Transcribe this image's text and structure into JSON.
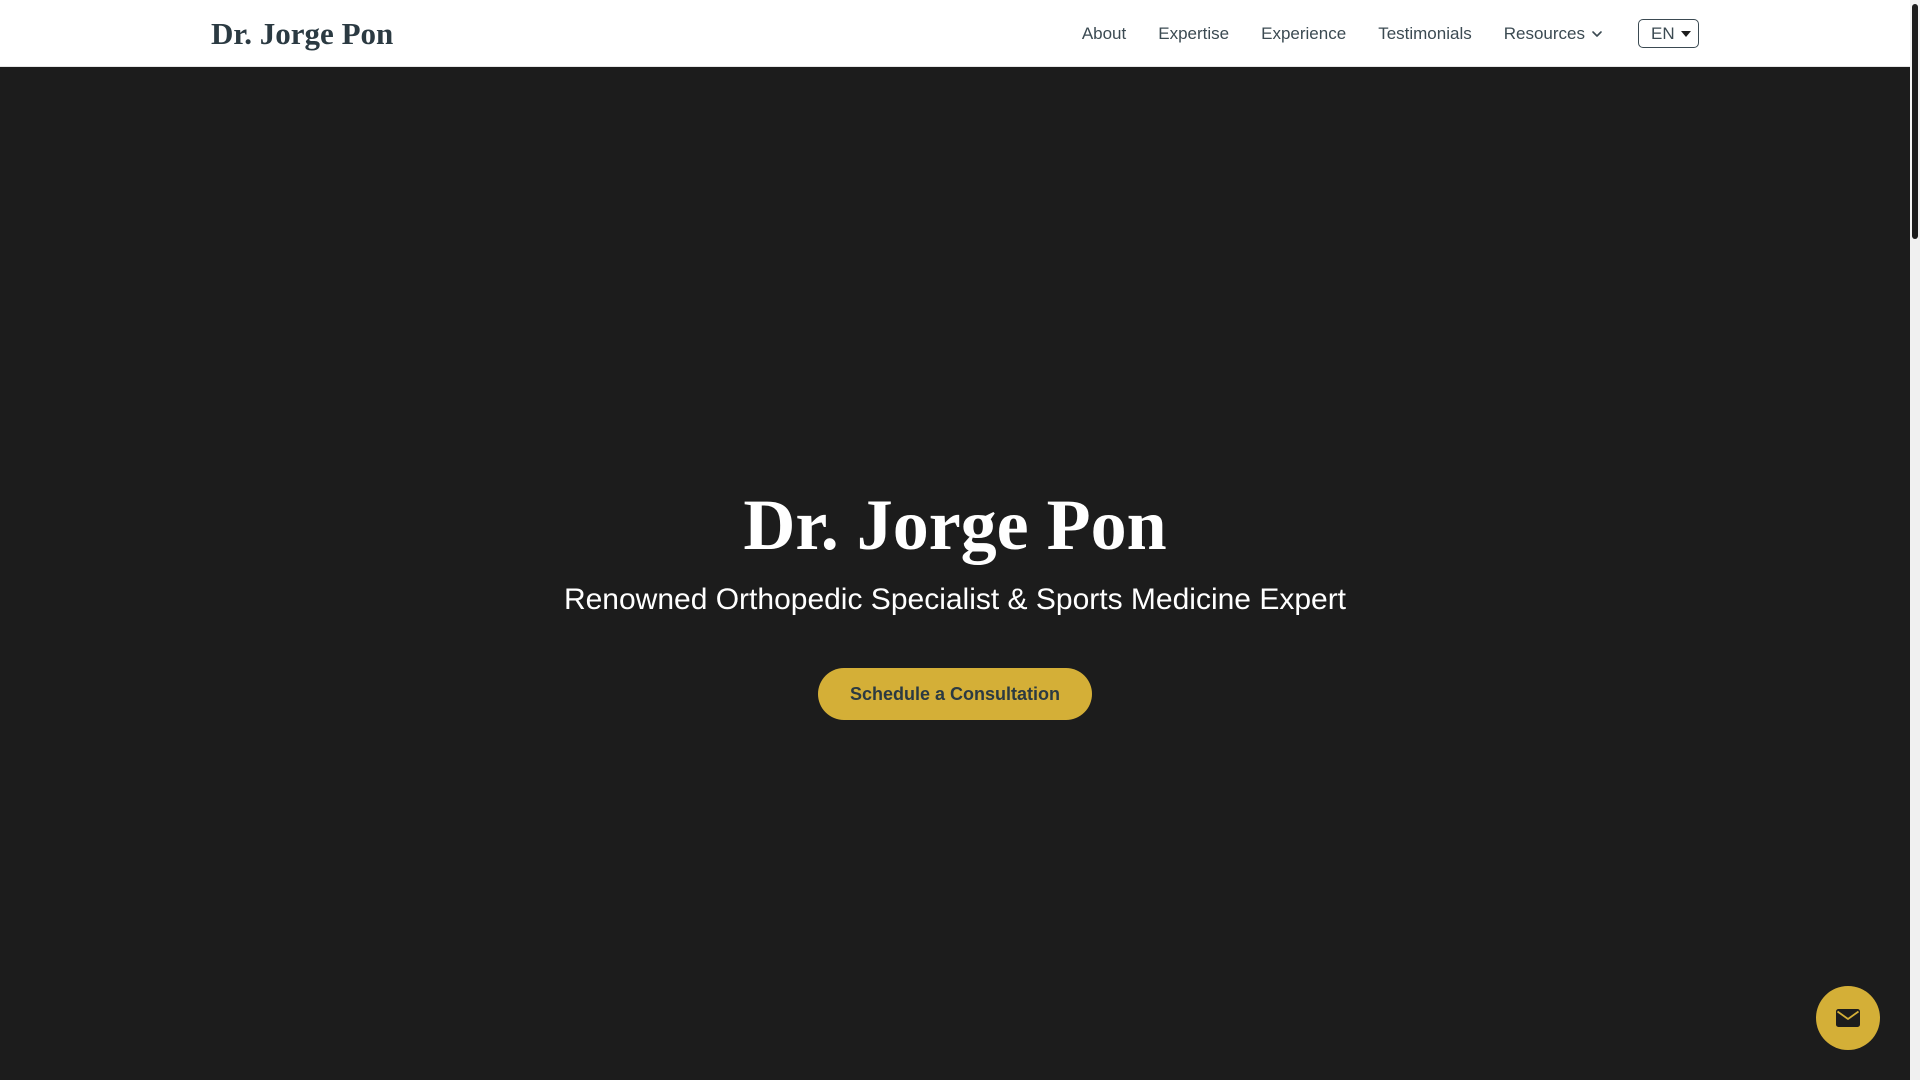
{
  "header": {
    "brand": "Dr. Jorge Pon",
    "nav": [
      "About",
      "Expertise",
      "Experience",
      "Testimonials",
      "Resources"
    ],
    "language": "EN"
  },
  "hero": {
    "title": "Dr. Jorge Pon",
    "subtitle": "Renowned Orthopedic Specialist & Sports Medicine Expert",
    "cta_label": "Schedule a Consultation"
  },
  "icons": {
    "resources_dropdown": "chevron-down-icon",
    "language_dropdown": "caret-down-icon",
    "contact": "envelope-icon"
  },
  "colors": {
    "accent": "#d4af37",
    "hero_bg": "#1c1c1c",
    "brand_text": "#2b3a42",
    "nav_text": "#3b4a52"
  }
}
